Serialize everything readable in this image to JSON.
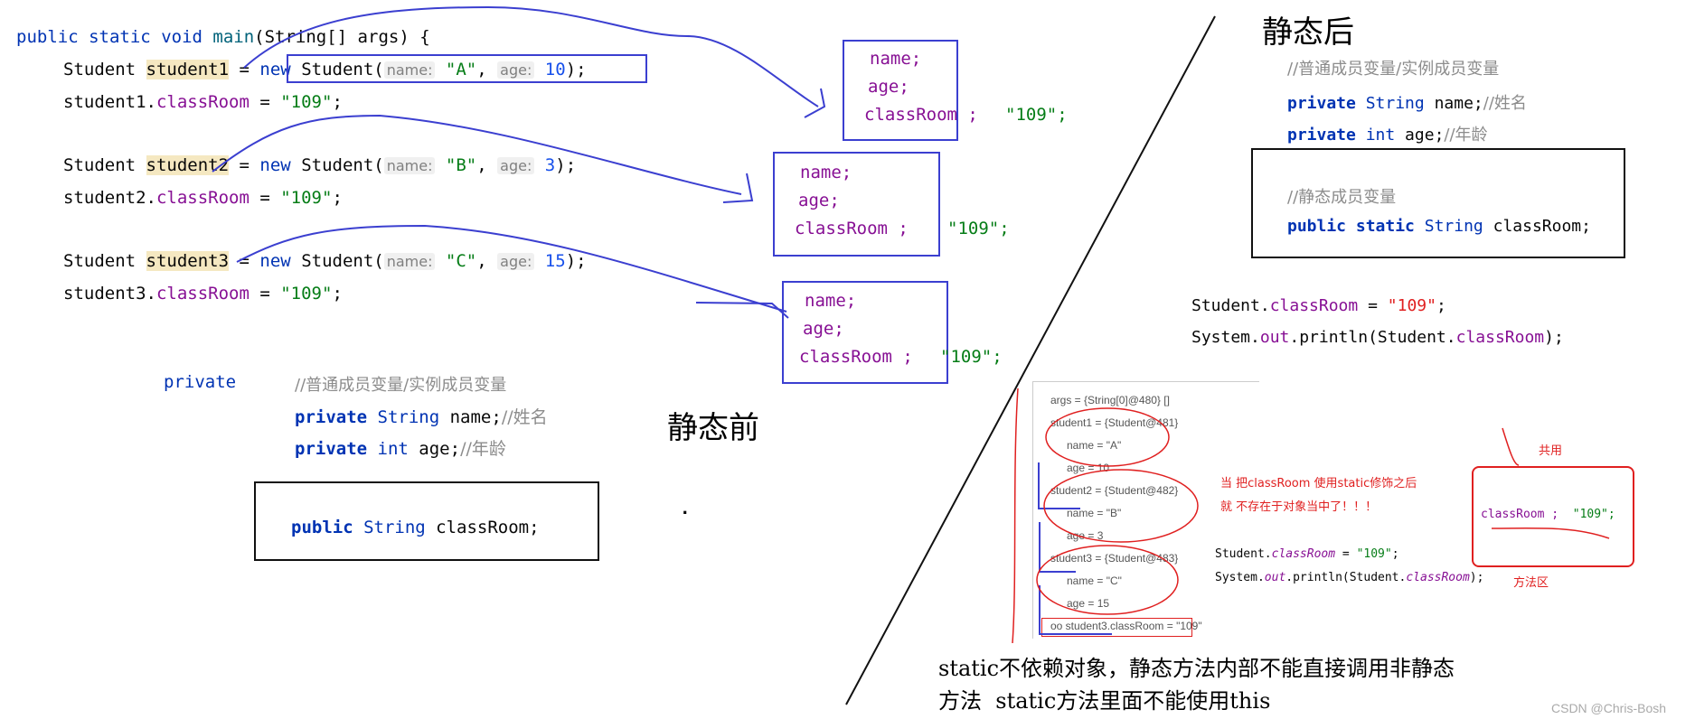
{
  "left_code": {
    "signature": {
      "public": "public",
      "static": "static",
      "void": "void",
      "main": "main",
      "rest": "(String[] args) {"
    },
    "students": [
      {
        "type": "Student",
        "var": "student1",
        "eq": "=",
        "new": "new",
        "ctor": "Student(",
        "name_hint": "name:",
        "name_val": "\"A\"",
        "age_hint": "age:",
        "age_val": "10",
        "end": ");",
        "assign_obj": "student1.",
        "assign_field": "classRoom",
        "assign_eq": " = ",
        "assign_val": "\"109\"",
        "semi": ";"
      },
      {
        "type": "Student",
        "var": "student2",
        "eq": "=",
        "new": "new",
        "ctor": "Student(",
        "name_hint": "name:",
        "name_val": "\"B\"",
        "age_hint": "age:",
        "age_val": "3",
        "end": ");",
        "assign_obj": "student2.",
        "assign_field": "classRoom",
        "assign_eq": " = ",
        "assign_val": "\"109\"",
        "semi": ";"
      },
      {
        "type": "Student",
        "var": "student3",
        "eq": "=",
        "new": "new",
        "ctor": "Student(",
        "name_hint": "name:",
        "name_val": "\"C\"",
        "age_hint": "age:",
        "age_val": "15",
        "end": ");",
        "assign_obj": "student3.",
        "assign_field": "classRoom",
        "assign_eq": " = ",
        "assign_val": "\"109\"",
        "semi": ";"
      }
    ]
  },
  "object_boxes": {
    "name": "name;",
    "age": "age;",
    "classroom": "classRoom ;",
    "value": "\"109\";"
  },
  "before": {
    "title": "静态前",
    "private_label": "private",
    "comment": "//普通成员变量/实例成员变量",
    "line1_kw": "private",
    "line1_type": "String",
    "line1_rest": " name;",
    "line1_cmt": "//姓名",
    "line2_kw": "private",
    "line2_type": "int",
    "line2_rest": " age;",
    "line2_cmt": "//年龄",
    "box_kw": "public",
    "box_type": "String",
    "box_rest": " classRoom;",
    "dot": "."
  },
  "after": {
    "title": "静态后",
    "comment": "//普通成员变量/实例成员变量",
    "line1_kw": "private",
    "line1_type": "String",
    "line1_rest": " name;",
    "line1_cmt": "//姓名",
    "line2_kw": "private",
    "line2_type": "int",
    "line2_rest": " age;",
    "line2_cmt": "//年龄",
    "box_comment": "//静态成员变量",
    "box_kw": "public static",
    "box_type": "String",
    "box_rest": " classRoom;",
    "usage1_obj": "Student.",
    "usage1_field": "classRoom",
    "usage1_eq": " = ",
    "usage1_val": "\"109\"",
    "usage1_semi": ";",
    "usage2_a": "System.",
    "usage2_out": "out",
    "usage2_b": ".println(Student.",
    "usage2_field": "classRoom",
    "usage2_c": ");"
  },
  "debugger": {
    "rows": [
      "args = {String[0]@480} []",
      "student1 = {Student@481}",
      "name = \"A\"",
      "age = 10",
      "student2 = {Student@482}",
      "name = \"B\"",
      "age = 3",
      "student3 = {Student@483}",
      "name = \"C\"",
      "age = 15",
      "oo student3.classRoom = \"109\""
    ]
  },
  "annotations": {
    "red_line1": "当 把classRoom 使用static修饰之后",
    "red_line2": "就 不存在于对象当中了！！！",
    "code1_obj": "Student.",
    "code1_field": "classRoom",
    "code1_rest": " = ",
    "code1_val": "\"109\"",
    "code1_semi": ";",
    "code2_a": "System.",
    "code2_out": "out",
    "code2_b": ".println(Student.",
    "code2_field": "classRoom",
    "code2_c": ");",
    "shared": "共用",
    "method_area": "方法区",
    "box_field": "classRoom ;",
    "box_value": "\"109\";"
  },
  "footer": {
    "line1": "static不依赖对象，静态方法内部不能直接调用非静态",
    "line2": "方法  static方法里面不能使用this",
    "watermark": "CSDN @Chris-Bosh"
  },
  "colors": {
    "keyword": "#0033b3",
    "field": "#871094",
    "string": "#067d17",
    "number": "#1750eb",
    "pen_blue": "#3b3fd0",
    "pen_red": "#e02020"
  }
}
